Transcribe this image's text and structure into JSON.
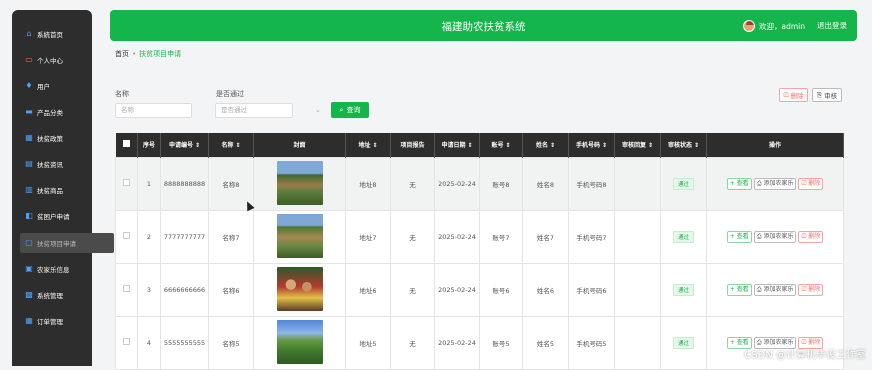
{
  "sidebar": {
    "items": [
      {
        "label": "系統首页",
        "icon": "home-icon",
        "glyph": "⌂"
      },
      {
        "label": "个人中心",
        "icon": "user-card-icon",
        "glyph": "▭"
      },
      {
        "label": "用户",
        "icon": "user-icon",
        "glyph": "♦"
      },
      {
        "label": "产品分类",
        "icon": "category-icon",
        "glyph": "▬"
      },
      {
        "label": "扶贫政策",
        "icon": "policy-icon",
        "glyph": "▦"
      },
      {
        "label": "扶贫资讯",
        "icon": "news-icon",
        "glyph": "▤"
      },
      {
        "label": "扶贫商品",
        "icon": "goods-icon",
        "glyph": "▥"
      },
      {
        "label": "贫困户申请",
        "icon": "apply-icon",
        "glyph": "◧"
      },
      {
        "label": "扶贫项目申请",
        "icon": "project-icon",
        "glyph": "▢"
      },
      {
        "label": "农家乐信息",
        "icon": "farm-icon",
        "glyph": "▣"
      },
      {
        "label": "系统管理",
        "icon": "settings-icon",
        "glyph": "▩"
      },
      {
        "label": "订单管理",
        "icon": "order-icon",
        "glyph": "▦"
      }
    ]
  },
  "header": {
    "title": "福建助农扶贫系统",
    "welcome": "欢迎，admin",
    "logout": "退出登录"
  },
  "breadcrumb": {
    "home": "首页",
    "separator": "•",
    "current": "扶贫项目申请"
  },
  "search": {
    "name_label": "名称",
    "name_placeholder": "名称",
    "pass_label": "是否通过",
    "pass_placeholder": "是否通过",
    "search_button": "查询"
  },
  "actions": {
    "delete": "删除",
    "audit": "审核"
  },
  "table": {
    "headers": [
      "序号",
      "申请编号 ⇕",
      "名称 ⇕",
      "封面",
      "地址 ⇕",
      "项目报告",
      "申请日期 ⇕",
      "账号 ⇕",
      "姓名 ⇕",
      "手机号码 ⇕",
      "审核回复 ⇕",
      "审核状态 ⇕",
      "操作"
    ],
    "rows": [
      {
        "index": "1",
        "code": "8888888888",
        "name": "名称8",
        "address": "地址8",
        "report": "无",
        "date": "2025-02-24",
        "account": "账号8",
        "realname": "姓名8",
        "phone": "手机号码8",
        "reply": "",
        "status": "通过"
      },
      {
        "index": "2",
        "code": "7777777777",
        "name": "名称7",
        "address": "地址7",
        "report": "无",
        "date": "2025-02-24",
        "account": "账号7",
        "realname": "姓名7",
        "phone": "手机号码7",
        "reply": "",
        "status": "通过"
      },
      {
        "index": "3",
        "code": "6666666666",
        "name": "名称6",
        "address": "地址6",
        "report": "无",
        "date": "2025-02-24",
        "account": "账号6",
        "realname": "姓名6",
        "phone": "手机号码6",
        "reply": "",
        "status": "通过"
      },
      {
        "index": "4",
        "code": "5555555555",
        "name": "名称5",
        "address": "地址5",
        "report": "无",
        "date": "2025-02-24",
        "account": "账号5",
        "realname": "姓名5",
        "phone": "手机号码5",
        "reply": "",
        "status": "通过"
      }
    ],
    "op_view": "查看",
    "op_add": "添加农家乐",
    "op_delete": "删除"
  },
  "watermark": "CSDN @计算机毕设工作室",
  "colors": {
    "primary": "#14b54a",
    "sidebar": "#2d2d2d",
    "danger": "#f56c6c"
  }
}
